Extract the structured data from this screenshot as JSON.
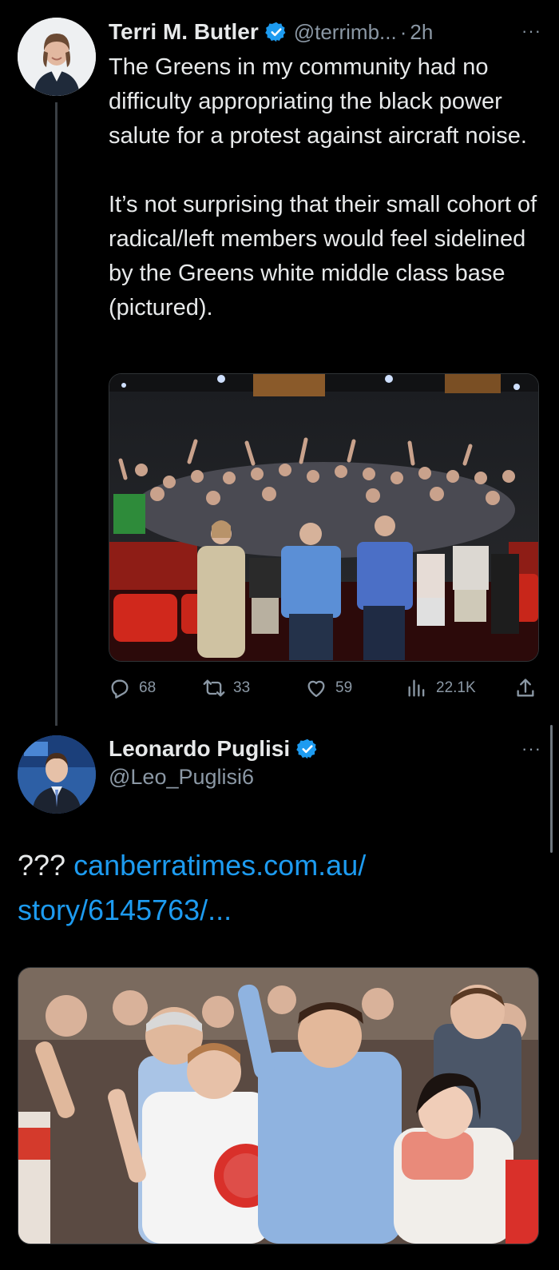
{
  "colors": {
    "background": "#000000",
    "text": "#e7e9ea",
    "secondary_text": "#8b98a5",
    "link": "#1d9bf0",
    "verified_badge": "#1d9bf0"
  },
  "tweet1": {
    "display_name": "Terri M. Butler",
    "handle": "@terrimb...",
    "separator": "·",
    "time": "2h",
    "more_label": "···",
    "paragraph1": "The Greens in my community had no difficulty appropriating the black power salute for a protest against aircraft noise.",
    "paragraph2": "It’s not surprising that their small cohort of radical/left members would feel sidelined by the Greens white middle class base (pictured).",
    "photo_icon": "photo-crowd-theatre",
    "stats": {
      "replies": "68",
      "retweets": "33",
      "likes": "59",
      "views": "22.1K"
    },
    "icons": {
      "reply": "reply-icon",
      "retweet": "retweet-icon",
      "like": "heart-icon",
      "views": "views-icon",
      "share": "share-icon"
    }
  },
  "tweet2": {
    "display_name": "Leonardo Puglisi",
    "handle": "@Leo_Puglisi6",
    "more_label": "···",
    "text_prefix": "??? ",
    "link_text": "canberratimes.com.au/ story/6145763/...",
    "photo_icon": "photo-campaign-celebration"
  }
}
